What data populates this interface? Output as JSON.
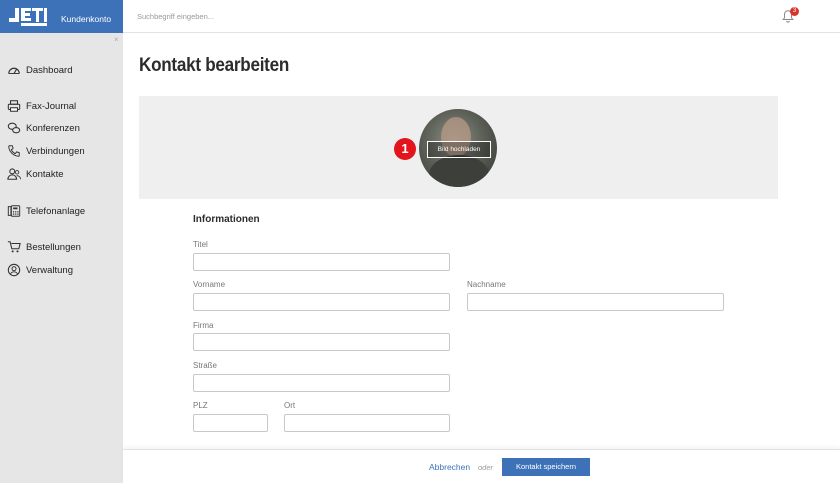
{
  "brand": {
    "logo_text": "JETI LINE",
    "account_label": "Kundenkonto"
  },
  "colors": {
    "brand": "#3d72b8",
    "sidebar_bg": "#e6e6e6",
    "badge": "#d9342b",
    "marker": "#e3141b"
  },
  "search": {
    "placeholder": "Suchbegriff eingeben..."
  },
  "notifications": {
    "count": "3"
  },
  "sidebar": {
    "items": [
      {
        "label": "Dashboard",
        "icon": "gauge-icon"
      },
      {
        "label": "Fax-Journal",
        "icon": "printer-icon"
      },
      {
        "label": "Konferenzen",
        "icon": "chat-bubbles-icon"
      },
      {
        "label": "Verbindungen",
        "icon": "phone-icon"
      },
      {
        "label": "Kontakte",
        "icon": "contacts-icon"
      },
      {
        "label": "Telefonanlage",
        "icon": "switchboard-icon"
      },
      {
        "label": "Bestellungen",
        "icon": "cart-icon"
      },
      {
        "label": "Verwaltung",
        "icon": "user-circle-icon"
      }
    ]
  },
  "page": {
    "title": "Kontakt bearbeiten"
  },
  "photo": {
    "upload_label": "Bild hochladen",
    "marker_number": "1"
  },
  "form": {
    "section_title": "Informationen",
    "fields": {
      "titel": {
        "label": "Titel",
        "value": ""
      },
      "vorname": {
        "label": "Vorname",
        "value": ""
      },
      "nachname": {
        "label": "Nachname",
        "value": ""
      },
      "firma": {
        "label": "Firma",
        "value": ""
      },
      "strasse": {
        "label": "Straße",
        "value": ""
      },
      "plz": {
        "label": "PLZ",
        "value": ""
      },
      "ort": {
        "label": "Ort",
        "value": ""
      }
    }
  },
  "footer": {
    "cancel_label": "Abbrechen",
    "or_label": "oder",
    "save_label": "Kontakt speichern"
  }
}
